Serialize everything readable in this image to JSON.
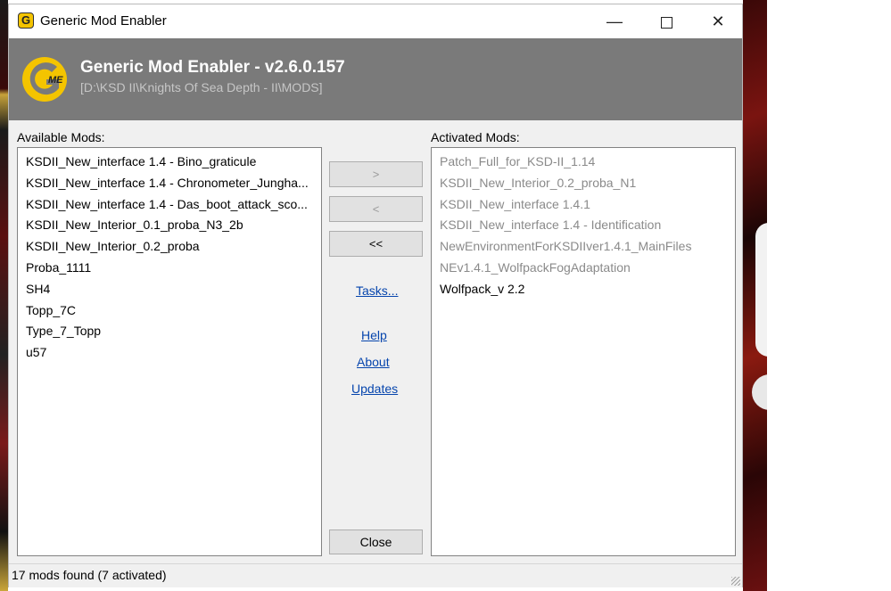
{
  "window": {
    "title": "Generic Mod Enabler",
    "controls": {
      "minimize": "—",
      "close": "✕"
    }
  },
  "banner": {
    "logo_letters": "G",
    "logo_small": "ME",
    "title": "Generic Mod Enabler - v2.6.0.157",
    "path": "[D:\\KSD II\\Knights Of Sea Depth - II\\MODS]"
  },
  "available": {
    "label": "Available Mods:",
    "items": [
      "KSDII_New_interface 1.4 - Bino_graticule",
      "KSDII_New_interface 1.4 - Chronometer_Jungha...",
      "KSDII_New_interface 1.4 - Das_boot_attack_sco...",
      "KSDII_New_Interior_0.1_proba_N3_2b",
      "KSDII_New_Interior_0.2_proba",
      "Proba_1111",
      "SH4",
      "Topp_7C",
      "Type_7_Topp",
      "u57"
    ]
  },
  "activated": {
    "label": "Activated Mods:",
    "items": [
      "Patch_Full_for_KSD-II_1.14",
      "KSDII_New_Interior_0.2_proba_N1",
      "KSDII_New_interface 1.4.1",
      "KSDII_New_interface 1.4 - Identification",
      "NewEnvironmentForKSDIIver1.4.1_MainFiles",
      "NEv1.4.1_WolfpackFogAdaptation",
      "Wolfpack_v 2.2"
    ]
  },
  "buttons": {
    "activate": ">",
    "deactivate": "<",
    "deactivate_all": "<<",
    "close": "Close"
  },
  "links": {
    "tasks": "Tasks...",
    "help": "Help",
    "about": "About",
    "updates": "Updates"
  },
  "status": {
    "text": "17 mods found (7 activated)"
  },
  "colors": {
    "banner": "#7a7a7a",
    "link": "#0645ad",
    "logo": "#f4c400"
  }
}
